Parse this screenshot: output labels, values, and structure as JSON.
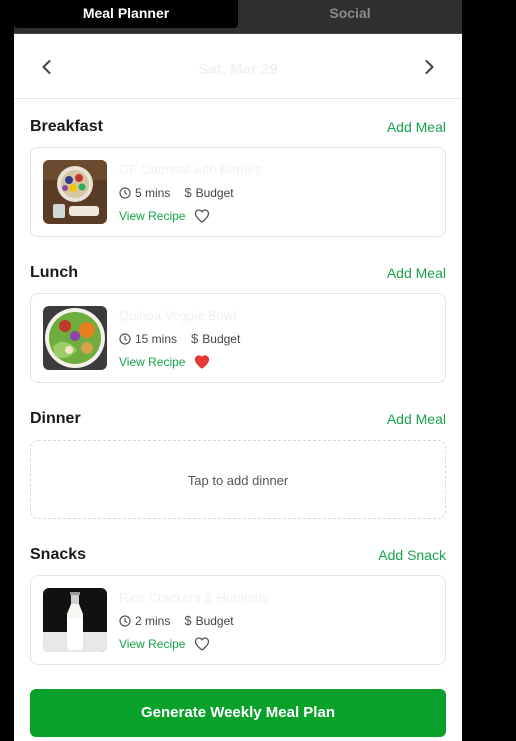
{
  "tabs": {
    "meal_planner": "Meal Planner",
    "social": "Social"
  },
  "date": {
    "label": "Sat, Mar 29"
  },
  "colors": {
    "accent": "#17a34a",
    "primary_button": "#0aa12a",
    "favorite": "#e53935"
  },
  "breakfast": {
    "title": "Breakfast",
    "action": "Add Meal",
    "meal": {
      "name": "GF Oatmeal with Berries",
      "time": "5 mins",
      "cost": "Budget",
      "recipe": "View Recipe",
      "favorite": false
    }
  },
  "lunch": {
    "title": "Lunch",
    "action": "Add Meal",
    "meal": {
      "name": "Quinoa Veggie Bowl",
      "time": "15 mins",
      "cost": "Budget",
      "recipe": "View Recipe",
      "favorite": true
    }
  },
  "dinner": {
    "title": "Dinner",
    "action": "Add Meal",
    "empty_text": "Tap to add dinner"
  },
  "snacks": {
    "title": "Snacks",
    "action": "Add Snack",
    "meal": {
      "name": "Rice Crackers & Hummus",
      "time": "2 mins",
      "cost": "Budget",
      "recipe": "View Recipe",
      "favorite": false
    }
  },
  "generate_button": "Generate Weekly Meal Plan",
  "icons": {
    "prev": "chevron-left-icon",
    "next": "chevron-right-icon",
    "time": "clock-icon",
    "cost": "dollar-icon",
    "favorite": "heart-icon"
  }
}
